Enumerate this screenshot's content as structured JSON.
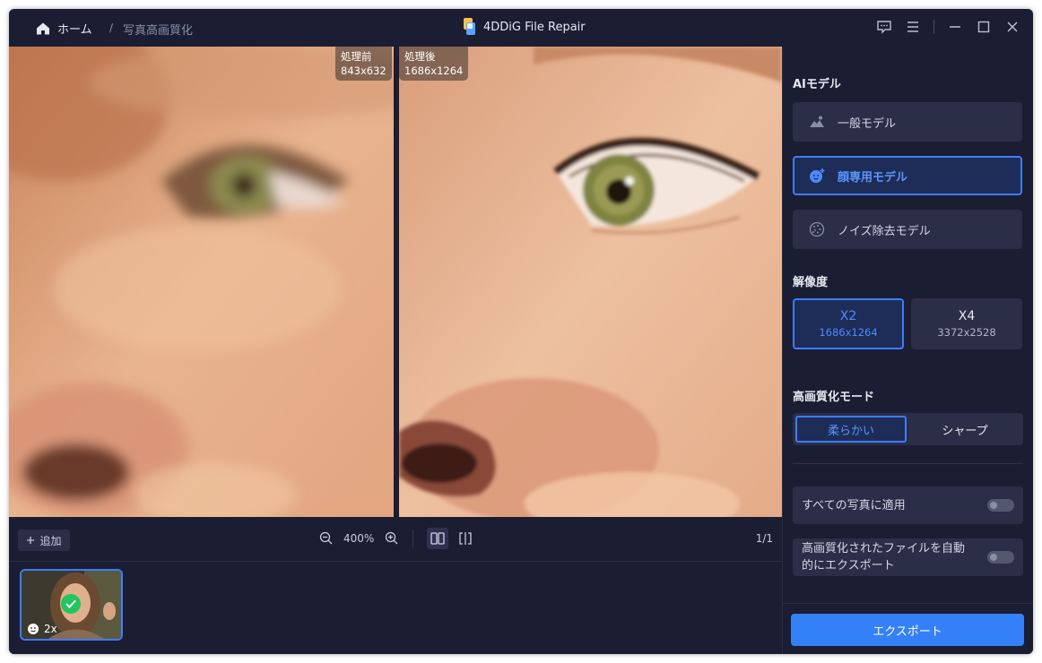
{
  "titlebar": {
    "home_label": "ホーム",
    "separator": "/",
    "page": "写真高画質化",
    "app_title": "4DDiG File Repair"
  },
  "compare": {
    "before_label": "処理前",
    "before_size": "843x632",
    "after_label": "処理後",
    "after_size": "1686x1264"
  },
  "toolbar": {
    "add_label": "追加",
    "zoom": "400%",
    "pager": "1/1"
  },
  "thumbnail": {
    "scale": "2x",
    "selected": true
  },
  "panel": {
    "ai_model_title": "AIモデル",
    "models": [
      {
        "label": "一般モデル",
        "icon": "landscape-icon",
        "active": false
      },
      {
        "label": "顔専用モデル",
        "icon": "face-plus-icon",
        "active": true
      },
      {
        "label": "ノイズ除去モデル",
        "icon": "noise-icon",
        "active": false
      }
    ],
    "resolution_title": "解像度",
    "resolutions": [
      {
        "label": "X2",
        "size": "1686x1264",
        "active": true
      },
      {
        "label": "X4",
        "size": "3372x2528",
        "active": false
      }
    ],
    "mode_title": "高画質化モード",
    "modes": [
      {
        "label": "柔らかい",
        "active": true
      },
      {
        "label": "シャープ",
        "active": false
      }
    ],
    "apply_all_label": "すべての写真に適用",
    "auto_export_label": "高画質化されたファイルを自動的にエクスポート",
    "apply_all_on": false,
    "auto_export_on": false,
    "export_label": "エクスポート"
  },
  "colors": {
    "background": "#1b1d33",
    "card": "#2b2e47",
    "accent": "#3d7dff",
    "export": "#3480f7"
  }
}
